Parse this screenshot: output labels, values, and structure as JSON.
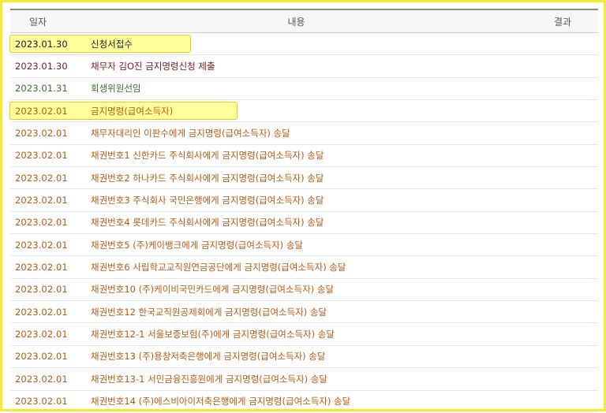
{
  "table": {
    "headers": {
      "date": "일자",
      "content": "내용",
      "result": "결과"
    },
    "rows": [
      {
        "date": "2023.01.30",
        "content": "신청서접수",
        "result": "",
        "tone": "black",
        "highlight": true
      },
      {
        "date": "2023.01.30",
        "content": "채무자 김O진 금지명령신청 제출",
        "result": "",
        "tone": "maroon",
        "highlight": false
      },
      {
        "date": "2023.01.31",
        "content": "회생위원선임",
        "result": "",
        "tone": "green",
        "highlight": false
      },
      {
        "date": "2023.02.01",
        "content": "금지명령(급여소득자)",
        "result": "",
        "tone": "orange",
        "highlight": true
      },
      {
        "date": "2023.02.01",
        "content": "채무자대리인 이판수에게 금지명령(급여소득자) 송달",
        "result": "",
        "tone": "orange",
        "highlight": false
      },
      {
        "date": "2023.02.01",
        "content": "채권번호1 신한카드 주식회사에게 금지명령(급여소득자) 송달",
        "result": "",
        "tone": "orange",
        "highlight": false
      },
      {
        "date": "2023.02.01",
        "content": "채권번호2 하나카드 주식회사에게 금지명령(급여소득자) 송달",
        "result": "",
        "tone": "orange",
        "highlight": false
      },
      {
        "date": "2023.02.01",
        "content": "채권번호3 주식회사 국민은행에게 금지명령(급여소득자) 송달",
        "result": "",
        "tone": "orange",
        "highlight": false
      },
      {
        "date": "2023.02.01",
        "content": "채권번호4 롯데카드 주식회사에게 금지명령(급여소득자) 송달",
        "result": "",
        "tone": "orange",
        "highlight": false
      },
      {
        "date": "2023.02.01",
        "content": "채권번호5 (주)케이뱅크에게 금지명령(급여소득자) 송달",
        "result": "",
        "tone": "orange",
        "highlight": false
      },
      {
        "date": "2023.02.01",
        "content": "채권번호6 사립학교교직원연금공단에게 금지명령(급여소득자) 송달",
        "result": "",
        "tone": "orange",
        "highlight": false
      },
      {
        "date": "2023.02.01",
        "content": "채권번호10 (주)케이비국민카드에게 금지명령(급여소득자) 송달",
        "result": "",
        "tone": "orange",
        "highlight": false
      },
      {
        "date": "2023.02.01",
        "content": "채권번호12 한국교직원공제회에게 금지명령(급여소득자) 송달",
        "result": "",
        "tone": "orange",
        "highlight": false
      },
      {
        "date": "2023.02.01",
        "content": "채권번호12-1 서울보증보험(주)에게 금지명령(급여소득자) 송달",
        "result": "",
        "tone": "orange",
        "highlight": false
      },
      {
        "date": "2023.02.01",
        "content": "채권번호13 (주)용창저축은행에게 금지명령(급여소득자) 송달",
        "result": "",
        "tone": "orange",
        "highlight": false
      },
      {
        "date": "2023.02.01",
        "content": "채권번호13-1 서민금융진흥원에게 금지명령(급여소득자) 송달",
        "result": "",
        "tone": "orange",
        "highlight": false
      },
      {
        "date": "2023.02.01",
        "content": "채권번호14 (주)에스비아이저축은행에게 금지명령(급여소득자) 송달",
        "result": "",
        "tone": "orange",
        "highlight": false
      }
    ]
  },
  "colors": {
    "frame_border": "#f5ea2f",
    "highlight_fill": "#ffff9c",
    "highlight_border": "#e0d21a",
    "black": "#1c1c1c",
    "maroon": "#7a1b1b",
    "green": "#3f6b3a",
    "orange": "#b85a10"
  }
}
